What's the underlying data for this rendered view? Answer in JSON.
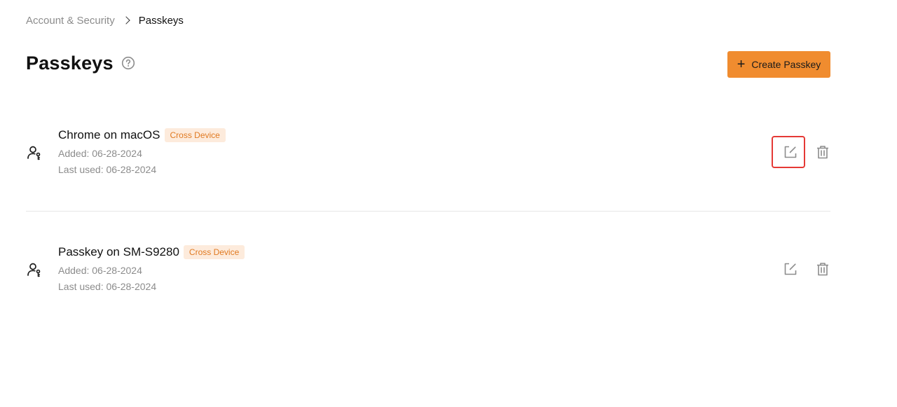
{
  "breadcrumb": {
    "parent": "Account & Security",
    "current": "Passkeys"
  },
  "page": {
    "title": "Passkeys"
  },
  "toolbar": {
    "create_label": "Create Passkey"
  },
  "passkeys": [
    {
      "name": "Chrome on macOS",
      "badge": "Cross Device",
      "added": "Added: 06-28-2024",
      "last_used": "Last used: 06-28-2024"
    },
    {
      "name": "Passkey on SM-S9280",
      "badge": "Cross Device",
      "added": "Added: 06-28-2024",
      "last_used": "Last used: 06-28-2024"
    }
  ],
  "icons": {
    "help": "question-circle-icon",
    "passkey": "user-key-icon",
    "edit": "edit-icon",
    "delete": "trash-icon"
  },
  "colors": {
    "accent": "#f08c2f",
    "badge_bg": "#fdebdc",
    "badge_text": "#e07a22",
    "highlight": "#e53935"
  }
}
